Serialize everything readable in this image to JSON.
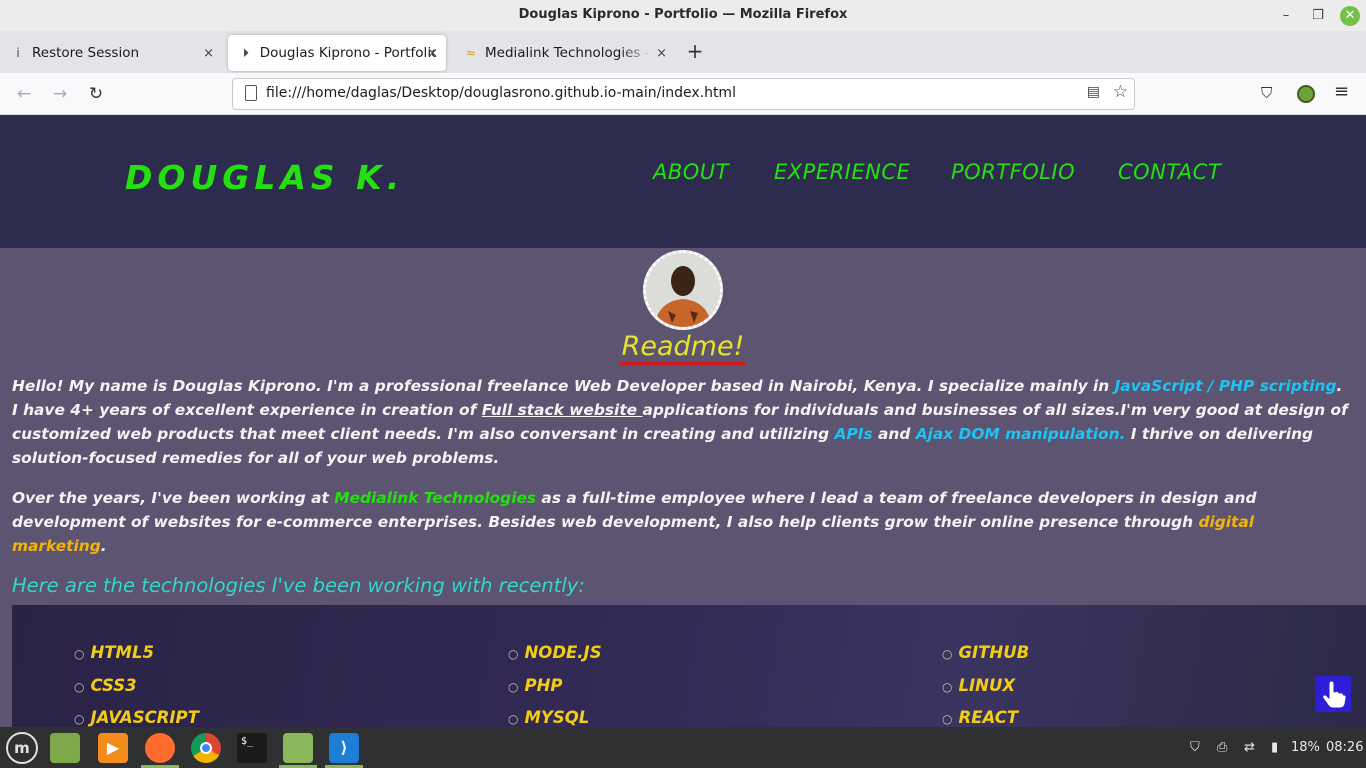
{
  "window": {
    "title": "Douglas Kiprono - Portfolio — Mozilla Firefox",
    "minimize_icon": "–",
    "maximize_icon": "❐",
    "close_icon": "✕"
  },
  "tabs": [
    {
      "label": "Restore Session",
      "icon": "i"
    },
    {
      "label": "Douglas Kiprono - Portfolio",
      "icon": "⏵"
    },
    {
      "label": "Medialink Technologies - Be",
      "icon": "≈"
    }
  ],
  "new_tab_icon": "+",
  "tab_close_icon": "×",
  "nav": {
    "back_icon": "←",
    "forward_icon": "→",
    "reload_icon": "↻",
    "url": "file:///home/daglas/Desktop/douglasrono.github.io-main/index.html",
    "reader_icon": "▤",
    "star_icon": "☆",
    "pocket_icon": "⛉",
    "menu_icon": "≡"
  },
  "site": {
    "brand": "DOUGLAS K.",
    "menu": [
      "ABOUT",
      "EXPERIENCE",
      "PORTFOLIO",
      "CONTACT"
    ],
    "readme": "Readme!",
    "intro": {
      "p1": "Hello! My name is Douglas Kiprono. I'm a professional freelance Web Developer based in Nairobi, Kenya. I specialize mainly in ",
      "l1": "JavaScript / PHP scripting",
      "p2": ". I have 4+ years of excellent experience in creation of ",
      "l2": "Full stack website ",
      "p3": "applications for individuals and businesses of all sizes.I'm very good at design of customized web products that meet client needs. I'm also conversant in creating and utilizing ",
      "l3": "APIs",
      "p4": " and ",
      "l4": "Ajax DOM manipulation.",
      "p5": " I thrive on delivering solution-focused remedies for all of your web problems."
    },
    "experience": {
      "p1": "Over the years, I've been working at ",
      "l1": "Medialink Technologies",
      "p2": " as a full-time employee where I lead a team of freelance developers in design and development of websites for e-commerce enterprises. Besides web development, I also help clients grow their online presence through ",
      "l2": "digital marketing",
      "p3": "."
    },
    "tech_heading": "Here are the technologies I've been working with recently:",
    "technologies": [
      "HTML5",
      "CSS3",
      "JAVASCRIPT",
      "NODE.JS",
      "PHP",
      "MYSQL",
      "GITHUB",
      "LINUX",
      "REACT"
    ],
    "bullet": "○"
  },
  "taskbar": {
    "battery": "18%",
    "time": "08:26",
    "terminal_label": "$_"
  }
}
